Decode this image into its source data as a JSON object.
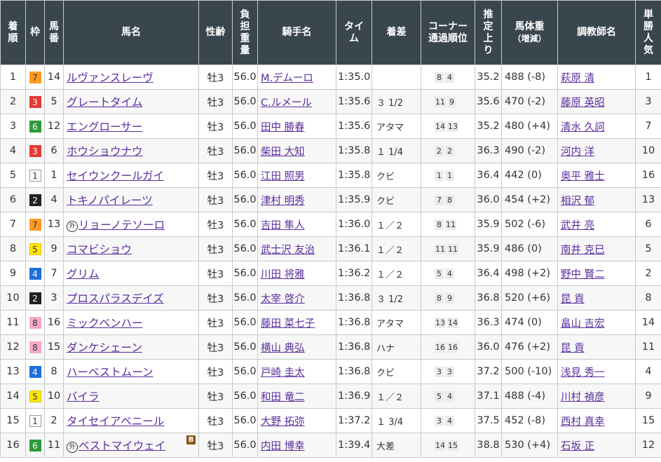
{
  "headers": [
    "着\n順",
    "枠",
    "馬\n番",
    "馬名",
    "性齢",
    "負\n担\n重\n量",
    "騎手名",
    "タイ\nム",
    "着差",
    "コーナー\n通過順位",
    "推\n定\n上\nり",
    "馬体重\n（増減）",
    "調教師名",
    "単\n勝\n人\n気"
  ],
  "rows": [
    {
      "pos": "1",
      "waku": "7",
      "num": "14",
      "mark": "",
      "horse": "ルヴァンスレーヴ",
      "blink": "",
      "sex": "牡3",
      "wt": "56.0",
      "jockey": "M.デムーロ",
      "time": "1:35.0",
      "margin": "",
      "c1": "8",
      "c2": "4",
      "last": "35.2",
      "bw": "488 (-8)",
      "trainer": "萩原 清",
      "pop": "1"
    },
    {
      "pos": "2",
      "waku": "3",
      "num": "5",
      "mark": "",
      "horse": "グレートタイム",
      "blink": "",
      "sex": "牡3",
      "wt": "56.0",
      "jockey": "C.ルメール",
      "time": "1:35.6",
      "margin": "３ 1/2",
      "c1": "11",
      "c2": "9",
      "last": "35.6",
      "bw": "470 (-2)",
      "trainer": "藤原 英昭",
      "pop": "3"
    },
    {
      "pos": "3",
      "waku": "6",
      "num": "12",
      "mark": "",
      "horse": "エングローサー",
      "blink": "",
      "sex": "牡3",
      "wt": "56.0",
      "jockey": "田中 勝春",
      "time": "1:35.6",
      "margin": "アタマ",
      "c1": "14",
      "c2": "13",
      "last": "35.2",
      "bw": "480 (+4)",
      "trainer": "清水 久詞",
      "pop": "7"
    },
    {
      "pos": "4",
      "waku": "3",
      "num": "6",
      "mark": "",
      "horse": "ホウショウナウ",
      "blink": "",
      "sex": "牡3",
      "wt": "56.0",
      "jockey": "柴田 大知",
      "time": "1:35.8",
      "margin": "１ 1/4",
      "c1": "2",
      "c2": "2",
      "last": "36.3",
      "bw": "490 (-2)",
      "trainer": "河内 洋",
      "pop": "10"
    },
    {
      "pos": "5",
      "waku": "1",
      "num": "1",
      "mark": "",
      "horse": "セイウンクールガイ",
      "blink": "",
      "sex": "牡3",
      "wt": "56.0",
      "jockey": "江田 照男",
      "time": "1:35.8",
      "margin": "クビ",
      "c1": "1",
      "c2": "1",
      "last": "36.4",
      "bw": "442 (0)",
      "trainer": "奥平 雅士",
      "pop": "16"
    },
    {
      "pos": "6",
      "waku": "2",
      "num": "4",
      "mark": "",
      "horse": "トキノパイレーツ",
      "blink": "",
      "sex": "牡3",
      "wt": "56.0",
      "jockey": "津村 明秀",
      "time": "1:35.9",
      "margin": "クビ",
      "c1": "7",
      "c2": "8",
      "last": "36.0",
      "bw": "454 (+2)",
      "trainer": "相沢 郁",
      "pop": "13"
    },
    {
      "pos": "7",
      "waku": "7",
      "num": "13",
      "mark": "外",
      "horse": "リョーノテソーロ",
      "blink": "",
      "sex": "牡3",
      "wt": "56.0",
      "jockey": "吉田 隼人",
      "time": "1:36.0",
      "margin": "１／２",
      "c1": "8",
      "c2": "11",
      "last": "35.9",
      "bw": "502 (-6)",
      "trainer": "武井 亮",
      "pop": "6"
    },
    {
      "pos": "8",
      "waku": "5",
      "num": "9",
      "mark": "",
      "horse": "コマビショウ",
      "blink": "",
      "sex": "牡3",
      "wt": "56.0",
      "jockey": "武士沢 友治",
      "time": "1:36.1",
      "margin": "１／２",
      "c1": "11",
      "c2": "11",
      "last": "35.9",
      "bw": "486 (0)",
      "trainer": "南井 克巳",
      "pop": "5"
    },
    {
      "pos": "9",
      "waku": "4",
      "num": "7",
      "mark": "",
      "horse": "グリム",
      "blink": "",
      "sex": "牡3",
      "wt": "56.0",
      "jockey": "川田 将雅",
      "time": "1:36.2",
      "margin": "１／２",
      "c1": "5",
      "c2": "4",
      "last": "36.4",
      "bw": "498 (+2)",
      "trainer": "野中 賢二",
      "pop": "2"
    },
    {
      "pos": "10",
      "waku": "2",
      "num": "3",
      "mark": "",
      "horse": "プロスパラスデイズ",
      "blink": "",
      "sex": "牡3",
      "wt": "56.0",
      "jockey": "太宰 啓介",
      "time": "1:36.8",
      "margin": "３ 1/2",
      "c1": "8",
      "c2": "9",
      "last": "36.8",
      "bw": "520 (+6)",
      "trainer": "昆 貢",
      "pop": "8"
    },
    {
      "pos": "11",
      "waku": "8",
      "num": "16",
      "mark": "",
      "horse": "ミックベンハー",
      "blink": "",
      "sex": "牡3",
      "wt": "56.0",
      "jockey": "藤田 菜七子",
      "time": "1:36.8",
      "margin": "アタマ",
      "c1": "13",
      "c2": "14",
      "last": "36.3",
      "bw": "474 (0)",
      "trainer": "畠山 吉宏",
      "pop": "14"
    },
    {
      "pos": "12",
      "waku": "8",
      "num": "15",
      "mark": "",
      "horse": "ダンケシェーン",
      "blink": "",
      "sex": "牡3",
      "wt": "56.0",
      "jockey": "横山 典弘",
      "time": "1:36.8",
      "margin": "ハナ",
      "c1": "16",
      "c2": "16",
      "last": "36.0",
      "bw": "476 (+2)",
      "trainer": "昆 貢",
      "pop": "11"
    },
    {
      "pos": "13",
      "waku": "4",
      "num": "8",
      "mark": "",
      "horse": "ハーベストムーン",
      "blink": "",
      "sex": "牡3",
      "wt": "56.0",
      "jockey": "戸崎 圭太",
      "time": "1:36.8",
      "margin": "クビ",
      "c1": "3",
      "c2": "3",
      "last": "37.2",
      "bw": "500 (-10)",
      "trainer": "浅見 秀一",
      "pop": "4"
    },
    {
      "pos": "14",
      "waku": "5",
      "num": "10",
      "mark": "",
      "horse": "バイラ",
      "blink": "",
      "sex": "牡3",
      "wt": "56.0",
      "jockey": "和田 竜二",
      "time": "1:36.9",
      "margin": "１／２",
      "c1": "5",
      "c2": "4",
      "last": "37.1",
      "bw": "488 (-4)",
      "trainer": "川村 禎彦",
      "pop": "9"
    },
    {
      "pos": "15",
      "waku": "1",
      "num": "2",
      "mark": "",
      "horse": "タイセイアベニール",
      "blink": "",
      "sex": "牡3",
      "wt": "56.0",
      "jockey": "大野 拓弥",
      "time": "1:37.2",
      "margin": "１ 3/4",
      "c1": "3",
      "c2": "4",
      "last": "37.5",
      "bw": "452 (-8)",
      "trainer": "西村 真幸",
      "pop": "15"
    },
    {
      "pos": "16",
      "waku": "6",
      "num": "11",
      "mark": "外",
      "horse": "ベストマイウェイ",
      "blink": "B",
      "sex": "牡3",
      "wt": "56.0",
      "jockey": "内田 博幸",
      "time": "1:39.4",
      "margin": "大差",
      "c1": "14",
      "c2": "15",
      "last": "38.8",
      "bw": "530 (+4)",
      "trainer": "石坂 正",
      "pop": "12"
    }
  ],
  "waku_colors": {
    "1": {
      "bg": "#ffffff",
      "fg": "#333333",
      "border": "#999999"
    },
    "2": {
      "bg": "#222222",
      "fg": "#ffffff",
      "border": "#222222"
    },
    "3": {
      "bg": "#e53935",
      "fg": "#ffffff",
      "border": "#e53935"
    },
    "4": {
      "bg": "#1e6fd9",
      "fg": "#ffffff",
      "border": "#1e6fd9"
    },
    "5": {
      "bg": "#ffe600",
      "fg": "#333333",
      "border": "#e0c800"
    },
    "6": {
      "bg": "#2e9a3a",
      "fg": "#ffffff",
      "border": "#2e9a3a"
    },
    "7": {
      "bg": "#ff9a1f",
      "fg": "#333333",
      "border": "#ff9a1f"
    },
    "8": {
      "bg": "#f7a8c8",
      "fg": "#333333",
      "border": "#f7a8c8"
    }
  }
}
